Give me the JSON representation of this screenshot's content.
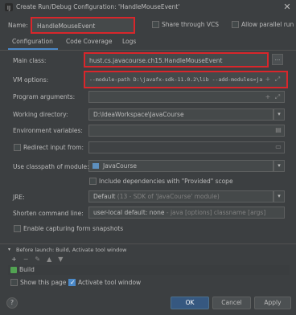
{
  "window": {
    "title": "Create Run/Debug Configuration: 'HandleMouseEvent'",
    "close_glyph": "✕"
  },
  "name_row": {
    "label": "Name:",
    "value": "HandleMouseEvent",
    "share_label": "Share through VCS",
    "allow_parallel_label": "Allow parallel run",
    "help_glyph": "?"
  },
  "tabs": [
    {
      "label": "Configuration",
      "active": true
    },
    {
      "label": "Code Coverage",
      "active": false
    },
    {
      "label": "Logs",
      "active": false
    }
  ],
  "form": {
    "main_class": {
      "label": "Main class:",
      "value": "hust.cs.javacourse.ch15.HandleMouseEvent",
      "button": "..."
    },
    "vm_options": {
      "label": "VM options:",
      "value": "--module-path D:\\javafx-sdk-11.0.2\\lib --add-modules=ja"
    },
    "program_args": {
      "label": "Program arguments:",
      "value": ""
    },
    "working_dir": {
      "label": "Working directory:",
      "value": "D:\\IdeaWorkspace\\JavaCourse"
    },
    "env_vars": {
      "label": "Environment variables:",
      "value": ""
    },
    "redirect": {
      "label": "Redirect input from:",
      "value": ""
    },
    "classpath": {
      "label": "Use classpath of module:",
      "value": "JavaCourse"
    },
    "include_deps": {
      "label": "Include dependencies with \"Provided\" scope"
    },
    "jre": {
      "label": "JRE:",
      "value_main": "Default",
      "value_dim": "(13 - SDK of 'JavaCourse' module)"
    },
    "shorten": {
      "label": "Shorten command line:",
      "value_main": "user-local default: none",
      "value_dim": "- java [options] classname [args]"
    },
    "capture": {
      "label": "Enable capturing form snapshots"
    }
  },
  "before_launch": {
    "header": "Before launch: Build, Activate tool window",
    "toolbar": [
      "+",
      "−",
      "✎",
      "▲",
      "▼"
    ],
    "items": [
      "Build"
    ],
    "show_page_label": "Show this page",
    "activate_label": "Activate tool window"
  },
  "footer": {
    "help_glyph": "?",
    "ok": "OK",
    "cancel": "Cancel",
    "apply": "Apply"
  },
  "colors": {
    "background": "#3c3f41",
    "field": "#45494a",
    "accent": "#4a88c7",
    "highlight_box": "#d9262b",
    "primary_button": "#365880"
  }
}
